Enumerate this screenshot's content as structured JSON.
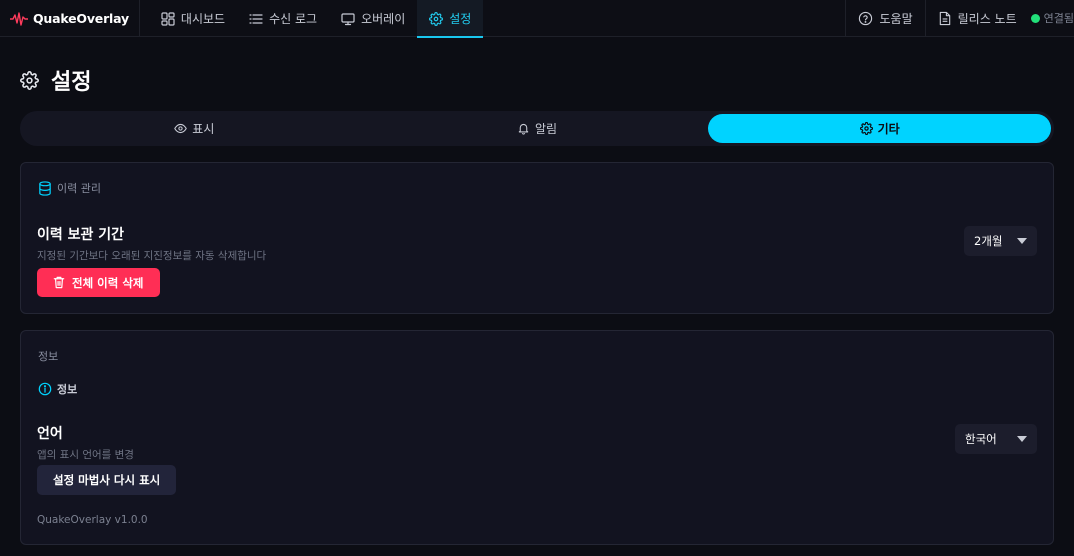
{
  "app": {
    "name": "QuakeOverlay"
  },
  "nav": {
    "items": [
      {
        "label": "대시보드",
        "icon": "dashboard-icon"
      },
      {
        "label": "수신 로그",
        "icon": "list-icon"
      },
      {
        "label": "오버레이",
        "icon": "monitor-icon"
      },
      {
        "label": "설정",
        "icon": "gear-icon",
        "active": true
      }
    ]
  },
  "topright": {
    "help_label": "도움말",
    "release_notes_label": "릴리스 노트",
    "status_text": "연결됨"
  },
  "page": {
    "title": "설정"
  },
  "tabs": [
    {
      "label": "표시",
      "icon": "eye-icon"
    },
    {
      "label": "알림",
      "icon": "bell-icon"
    },
    {
      "label": "기타",
      "icon": "gear-icon",
      "active": true
    }
  ],
  "history_section": {
    "label": "이력 관리",
    "retention_title": "이력 보관 기간",
    "retention_desc": "지정된 기간보다 오래된 지진정보를 자동 삭제합니다",
    "retention_value": "2개월",
    "delete_all_label": "전체 이력 삭제"
  },
  "info_section": {
    "label": "정보",
    "sub_label": "정보",
    "language_title": "언어",
    "language_desc": "앱의 표시 언어를 변경",
    "language_value": "한국어",
    "wizard_button_label": "설정 마법사 다시 표시",
    "version": "QuakeOverlay v1.0.0"
  },
  "colors": {
    "accent": "#00d3ff",
    "danger": "#ff2e55",
    "status_ok": "#22e07a",
    "background": "#0c0d14",
    "card": "#121320"
  }
}
